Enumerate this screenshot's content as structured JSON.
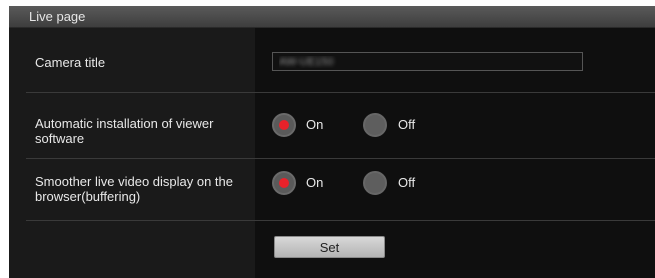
{
  "header": {
    "title": "Live page"
  },
  "camera_title": {
    "label": "Camera title",
    "value": "AW-UE150"
  },
  "auto_install": {
    "label": "Automatic installation of viewer software",
    "options": [
      {
        "label": "On",
        "selected": true
      },
      {
        "label": "Off",
        "selected": false
      }
    ]
  },
  "buffering": {
    "label": "Smoother live video display on the browser(buffering)",
    "options": [
      {
        "label": "On",
        "selected": true
      },
      {
        "label": "Off",
        "selected": false
      }
    ]
  },
  "actions": {
    "set_label": "Set"
  },
  "colors": {
    "accent_radio": "#e8222a",
    "header_bg": "#4a4a4a",
    "panel_bg": "#1e1e1e"
  }
}
